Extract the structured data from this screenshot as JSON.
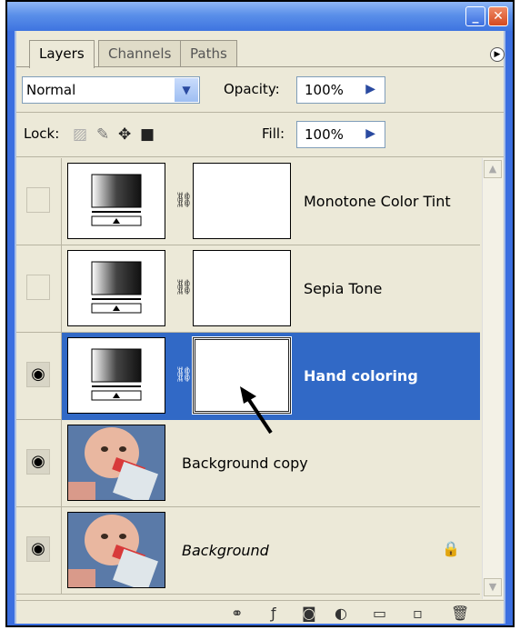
{
  "window": {
    "minimize_label": "_",
    "close_label": "✕"
  },
  "tabs": [
    {
      "label": "Layers",
      "active": true
    },
    {
      "label": "Channels",
      "active": false
    },
    {
      "label": "Paths",
      "active": false
    }
  ],
  "panel_menu_icon": "panel-menu-icon",
  "blend_mode": {
    "value": "Normal",
    "icon": "dropdown-arrow-icon"
  },
  "opacity": {
    "label": "Opacity:",
    "value": "100%"
  },
  "lock": {
    "label": "Lock:",
    "icons": [
      "lock-transparent-icon",
      "lock-brush-icon",
      "lock-move-icon",
      "lock-all-icon"
    ]
  },
  "fill": {
    "label": "Fill:",
    "value": "100%"
  },
  "layers": [
    {
      "name": "Monotone Color Tint",
      "visible": false,
      "type": "adjustment",
      "selected": false,
      "italic": false
    },
    {
      "name": "Sepia Tone",
      "visible": false,
      "type": "adjustment",
      "selected": false,
      "italic": false
    },
    {
      "name": "Hand coloring",
      "visible": true,
      "type": "adjustment",
      "selected": true,
      "italic": false
    },
    {
      "name": "Background copy",
      "visible": true,
      "type": "photo",
      "selected": false,
      "italic": false
    },
    {
      "name": "Background",
      "visible": true,
      "type": "photo",
      "selected": false,
      "italic": true,
      "locked": true
    }
  ],
  "bottom_icons": [
    "link-layers-icon",
    "layer-style-icon",
    "add-mask-icon",
    "adjustment-layer-icon",
    "new-group-icon",
    "new-layer-icon",
    "trash-icon"
  ],
  "colors": {
    "selection": "#3169c6",
    "panel_bg": "#ece9d8",
    "title_blue": "#3b6fe0"
  }
}
